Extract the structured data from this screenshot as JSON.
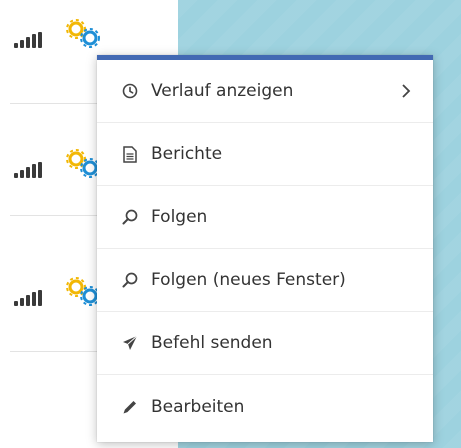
{
  "colors": {
    "menu_accent": "#4269b3",
    "map_background": "#9dd2df",
    "gear_primary": "#f2b705",
    "gear_secondary": "#1f8fd6",
    "text": "#333333"
  },
  "device_rows": [
    {
      "signal_icon": "signal-bars-icon",
      "status_icon": "gears-icon"
    },
    {
      "signal_icon": "signal-bars-icon",
      "status_icon": "gears-icon"
    },
    {
      "signal_icon": "signal-bars-icon",
      "status_icon": "gears-icon"
    }
  ],
  "context_menu": {
    "items": [
      {
        "label": "Verlauf anzeigen",
        "icon": "clock-icon",
        "has_submenu": true
      },
      {
        "label": "Berichte",
        "icon": "document-icon"
      },
      {
        "label": "Folgen",
        "icon": "search-icon"
      },
      {
        "label": "Folgen (neues Fenster)",
        "icon": "search-icon"
      },
      {
        "label": "Befehl senden",
        "icon": "send-icon"
      },
      {
        "label": "Bearbeiten",
        "icon": "pencil-icon"
      }
    ]
  }
}
